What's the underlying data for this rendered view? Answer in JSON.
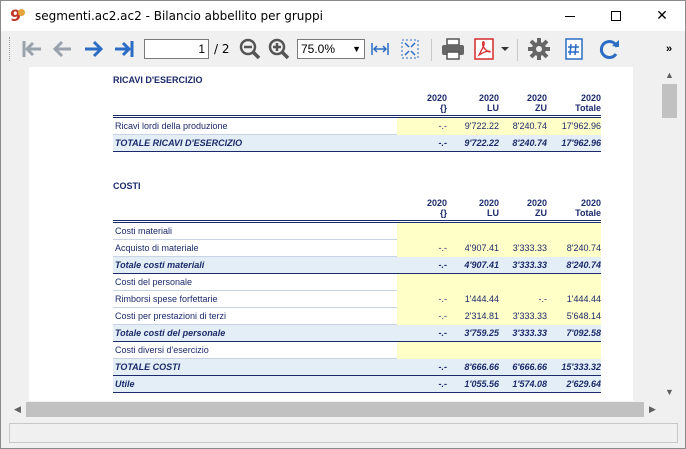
{
  "window": {
    "title": "segmenti.ac2.ac2 - Bilancio abbellito per gruppi",
    "app_icon": "9",
    "min_icon": "minimize-icon",
    "max_icon": "maximize-icon",
    "close_label": "✕"
  },
  "toolbar": {
    "page_value": "1",
    "page_total": "/ 2",
    "zoom_value": "75.0%",
    "zoom_options": [
      "75.0%"
    ],
    "more_label": "»",
    "accent": "#2b6cc4",
    "pdf_color": "#d62b2b"
  },
  "report": {
    "ricavi": {
      "title": "RICAVI D'ESERCIZIO",
      "headers": [
        {
          "year": "2020",
          "seg": "{}"
        },
        {
          "year": "2020",
          "seg": "LU"
        },
        {
          "year": "2020",
          "seg": "ZU"
        },
        {
          "year": "2020",
          "seg": "Totale"
        }
      ],
      "rows": [
        {
          "label": "Ricavi lordi della produzione",
          "v": [
            "-.-",
            "9'722.22",
            "8'240.74",
            "17'962.96"
          ],
          "type": "data"
        },
        {
          "label": "TOTALE RICAVI D'ESERCIZIO",
          "v": [
            "-.-",
            "9'722.22",
            "8'240.74",
            "17'962.96"
          ],
          "type": "total"
        }
      ]
    },
    "costi": {
      "title": "COSTI",
      "headers": [
        {
          "year": "2020",
          "seg": "{}"
        },
        {
          "year": "2020",
          "seg": "LU"
        },
        {
          "year": "2020",
          "seg": "ZU"
        },
        {
          "year": "2020",
          "seg": "Totale"
        }
      ],
      "rows": [
        {
          "label": "Costi materiali",
          "v": [
            "",
            "",
            "",
            ""
          ],
          "type": "data"
        },
        {
          "label": "Acquisto di materiale",
          "v": [
            "-.-",
            "4'907.41",
            "3'333.33",
            "8'240.74"
          ],
          "type": "data"
        },
        {
          "label": "Totale costi materiali",
          "v": [
            "-.-",
            "4'907.41",
            "3'333.33",
            "8'240.74"
          ],
          "type": "total"
        },
        {
          "label": "Costi del personale",
          "v": [
            "",
            "",
            "",
            ""
          ],
          "type": "data"
        },
        {
          "label": "Rimborsi spese forfettarie",
          "v": [
            "-.-",
            "1'444.44",
            "-.-",
            "1'444.44"
          ],
          "type": "data"
        },
        {
          "label": "Costi per prestazioni di terzi",
          "v": [
            "-.-",
            "2'314.81",
            "3'333.33",
            "5'648.14"
          ],
          "type": "data"
        },
        {
          "label": "Totale costi del personale",
          "v": [
            "-.-",
            "3'759.25",
            "3'333.33",
            "7'092.58"
          ],
          "type": "total"
        },
        {
          "label": "Costi diversi d'esercizio",
          "v": [
            "",
            "",
            "",
            ""
          ],
          "type": "data"
        },
        {
          "label": "TOTALE COSTI",
          "v": [
            "-.-",
            "8'666.66",
            "6'666.66",
            "15'333.32"
          ],
          "type": "total"
        },
        {
          "label": "Utile",
          "v": [
            "-.-",
            "1'055.56",
            "1'574.08",
            "2'629.64"
          ],
          "type": "total"
        }
      ]
    }
  }
}
